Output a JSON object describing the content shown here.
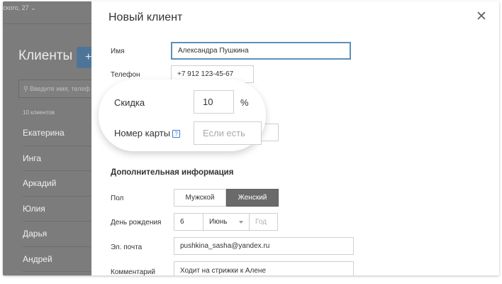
{
  "background": {
    "address": "ского, 27",
    "title": "Клиенты",
    "add_label": "+",
    "search_placeholder": "Введите имя, телеф",
    "count": "10 клиентов",
    "clients": [
      "Екатерина",
      "Инга",
      "Аркадий",
      "Юлия",
      "Дарья",
      "Андрей"
    ]
  },
  "modal": {
    "title": "Новый клиент",
    "close_label": "✕",
    "fields": {
      "name": {
        "label": "Имя",
        "value": "Александра Пушкина"
      },
      "phone": {
        "label": "Телефон",
        "value": "+7 912 123-45-67"
      },
      "discount": {
        "label": "Скидка",
        "value": "10",
        "unit": "%"
      },
      "card": {
        "label": "Номер карты",
        "placeholder": "Если есть",
        "help": "?"
      },
      "gender": {
        "label": "Пол",
        "options": [
          "Мужской",
          "Женский"
        ],
        "selected": "Женский"
      },
      "birthday": {
        "label": "День рождения",
        "day": "6",
        "month": "Июнь",
        "year_placeholder": "Год"
      },
      "email": {
        "label": "Эл. почта",
        "value": "pushkina_sasha@yandex.ru"
      },
      "comment": {
        "label": "Комментарий",
        "value": "Ходит на стрижки к Алене"
      }
    },
    "section_title": "Дополнительная информация"
  }
}
